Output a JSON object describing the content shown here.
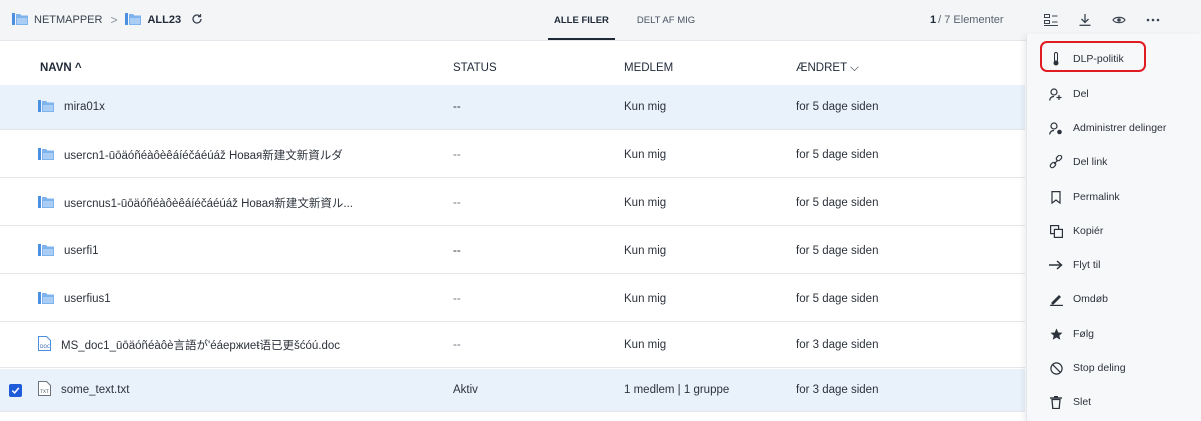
{
  "breadcrumb": {
    "root": "NETMAPPER",
    "separator": ">",
    "current": "ALL23"
  },
  "tabs": [
    {
      "label": "ALLE FILER",
      "active": true
    },
    {
      "label": "DELT AF MIG",
      "active": false
    }
  ],
  "counter": {
    "current": "1",
    "suffix": "/ 7 Elementer"
  },
  "toolbar_icons": [
    "details-icon",
    "download-icon",
    "view-icon",
    "more-icon"
  ],
  "columns": {
    "name": "NAVN ^",
    "status": "STATUS",
    "member": "MEDLEM",
    "changed": "ÆNDRET ⌵"
  },
  "rows": [
    {
      "name": "mira01x",
      "type": "folder",
      "status": "--",
      "member": "Kun mig",
      "changed": "for 5 dage siden",
      "highlighted": true,
      "selected": false
    },
    {
      "name": "usercn1-ūōäóñéàôèêáíéčáéúáž Новая新建文新資ルダ",
      "type": "folder",
      "status": "--",
      "member": "Kun mig",
      "changed": "for 5 dage siden",
      "highlighted": false,
      "selected": false
    },
    {
      "name": "usercnus1-ūōäóñéàôèêáíéčáéúáž Новая新建文新資ル...",
      "type": "folder",
      "status": "--",
      "member": "Kun mig",
      "changed": "for 5 dage siden",
      "highlighted": false,
      "selected": false
    },
    {
      "name": "userfi1",
      "type": "folder",
      "status": "--",
      "member": "Kun mig",
      "changed": "for 5 dage siden",
      "highlighted": false,
      "selected": false
    },
    {
      "name": "userfius1",
      "type": "folder",
      "status": "--",
      "member": "Kun mig",
      "changed": "for 5 dage siden",
      "highlighted": false,
      "selected": false
    },
    {
      "name": "MS_doc1_ūōäóñéàôè言語が'éáержиеŧ语已更šćóú.doc",
      "type": "doc",
      "status": "--",
      "member": "Kun mig",
      "changed": "for 3 dage siden",
      "highlighted": false,
      "selected": false
    },
    {
      "name": "some_text.txt",
      "type": "txt",
      "status": "Aktiv",
      "member": "1 medlem | 1 gruppe",
      "changed": "for 3 dage siden",
      "highlighted": true,
      "selected": true
    }
  ],
  "context_menu": [
    {
      "label": "DLP-politik",
      "icon": "thermometer-icon"
    },
    {
      "label": "Del",
      "icon": "add-user-icon"
    },
    {
      "label": "Administrer delinger",
      "icon": "manage-shares-icon"
    },
    {
      "label": "Del link",
      "icon": "link-icon"
    },
    {
      "label": "Permalink",
      "icon": "bookmark-icon"
    },
    {
      "label": "Kopiér",
      "icon": "copy-icon"
    },
    {
      "label": "Flyt til",
      "icon": "arrow-right-icon"
    },
    {
      "label": "Omdøb",
      "icon": "pencil-icon"
    },
    {
      "label": "Følg",
      "icon": "star-icon"
    },
    {
      "label": "Stop deling",
      "icon": "stop-icon"
    },
    {
      "label": "Slet",
      "icon": "trash-icon"
    }
  ],
  "colors": {
    "accent": "#1e5bd8",
    "highlight_row": "#e9f1fb",
    "outline": "#e11b22",
    "folder": "#4a8fe0"
  }
}
